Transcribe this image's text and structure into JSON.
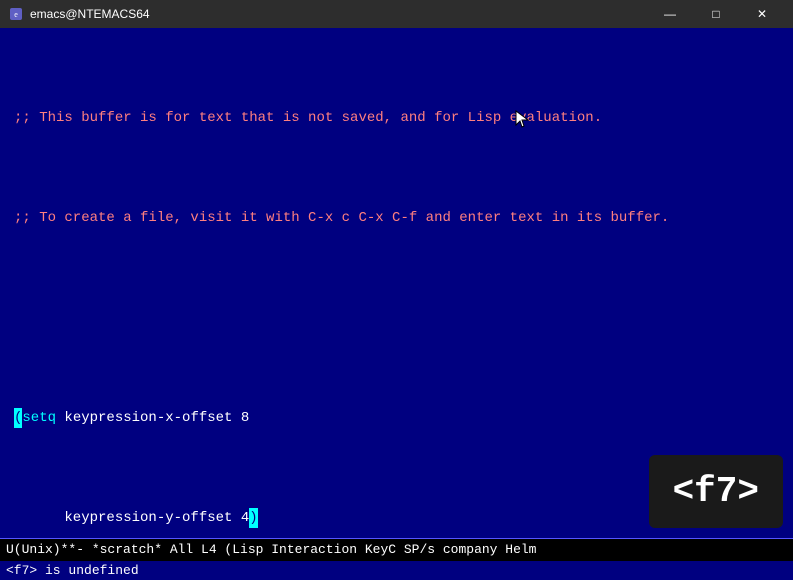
{
  "titlebar": {
    "title": "emacs@NTEMACS64",
    "minimize_label": "—",
    "maximize_label": "□",
    "close_label": "✕"
  },
  "editor": {
    "lines": [
      {
        "id": 1,
        "type": "comment",
        "text": ";; This buffer is for text that is not saved, and for Lisp evaluation."
      },
      {
        "id": 2,
        "type": "comment",
        "text": ";; To create a file, visit it with C-x c C-x C-f and enter text in its buffer."
      },
      {
        "id": 3,
        "type": "empty",
        "text": ""
      },
      {
        "id": 4,
        "type": "code",
        "text": "(setq keypression-x-offset 8"
      },
      {
        "id": 5,
        "type": "code",
        "text": "      keypression-y-offset 4)"
      }
    ]
  },
  "key_overlay": {
    "text": "<f7>"
  },
  "statusbar": {
    "text": "U(Unix)**-  *scratch*          All L4     (Lisp Interaction KeyC SP/s company Helm"
  },
  "minibuffer": {
    "text": "<f7> is undefined"
  }
}
